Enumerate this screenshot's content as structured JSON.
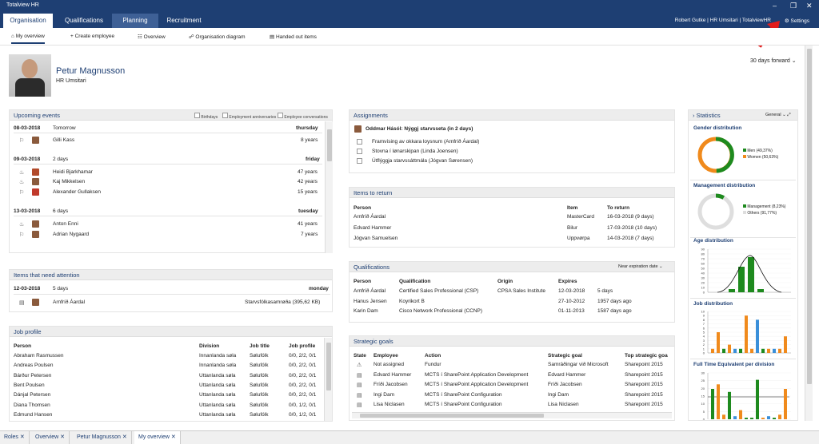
{
  "window": {
    "title": "Totalview HR"
  },
  "nav": {
    "tabs": [
      "Organisation",
      "Qualifications",
      "Planning",
      "Recruitment"
    ],
    "user": "Robert Gutke | HR Umsitari | TotalviewHR",
    "settings": "Settings"
  },
  "subnav": {
    "items": [
      "My overview",
      "Create employee",
      "Overview",
      "Organisation diagram",
      "Handed out items"
    ]
  },
  "profile": {
    "name": "Petur Magnusson",
    "role": "HR Umsitari",
    "period": "30 days forward"
  },
  "upcoming": {
    "title": "Upcoming events",
    "filters": [
      "Birthdays",
      "Employment anniversaries",
      "Employee conversations"
    ],
    "groups": [
      {
        "date": "08-03-2018",
        "rel": "Tomorrow",
        "day": "thursday",
        "people": [
          {
            "name": "Gilli Kass",
            "val": "8 years"
          }
        ]
      },
      {
        "date": "09-03-2018",
        "rel": "2 days",
        "day": "friday",
        "people": [
          {
            "name": "Heidi Bjarkhamar",
            "val": "47 years"
          },
          {
            "name": "Kaj Mikkelsen",
            "val": "42 years"
          },
          {
            "name": "Alexander Gullaksen",
            "val": "15 years"
          }
        ]
      },
      {
        "date": "13-03-2018",
        "rel": "6 days",
        "day": "tuesday",
        "people": [
          {
            "name": "Anton Enni",
            "val": "41 years"
          },
          {
            "name": "Adrian Nygaard",
            "val": "7 years"
          }
        ]
      }
    ]
  },
  "attention": {
    "title": "Items that need attention",
    "date": "12-03-2018",
    "rel": "5 days",
    "day": "monday",
    "person": "Arnfríð Áardal",
    "doc": "Starvsfólkasamrøða (395,62 KB)"
  },
  "job": {
    "title": "Job profile",
    "headers": [
      "Person",
      "Division",
      "Job title",
      "Job profile"
    ],
    "rows": [
      [
        "Abraham Rasmussen",
        "Innanlanda søla",
        "Sølufólk",
        "0/0, 2/2, 0/1"
      ],
      [
        "Andreas Poulsen",
        "Innanlanda søla",
        "Sølufólk",
        "0/0, 2/2, 0/1"
      ],
      [
        "Bárður Petersen",
        "Uttanlanda søla",
        "Sølufólk",
        "0/0, 2/2, 0/1"
      ],
      [
        "Bent Poulsen",
        "Uttanlanda søla",
        "Sølufólk",
        "0/0, 2/2, 0/1"
      ],
      [
        "Dánjal Petersen",
        "Uttanlanda søla",
        "Sølufólk",
        "0/0, 2/2, 0/1"
      ],
      [
        "Diana Thomsen",
        "Uttanlanda søla",
        "Sølufólk",
        "0/0, 1/2, 0/1"
      ],
      [
        "Edmund Hansen",
        "Uttanlanda søla",
        "Sølufólk",
        "0/0, 1/2, 0/1"
      ]
    ]
  },
  "assignments": {
    "title": "Assignments",
    "heading": "Oddmar Hásól: Nýggj starvsseta (in 2 days)",
    "items": [
      "Framvísing av okkara loysnum (Arnfríð Áardal)",
      "Stovna í lønarskipan (Linda Joensen)",
      "Útflýggja starvssáttmála (Jógvan Sørensen)"
    ]
  },
  "items_return": {
    "title": "Items to return",
    "headers": [
      "Person",
      "Item",
      "To return"
    ],
    "rows": [
      [
        "Arnfríð Áardal",
        "MasterCard",
        "16-03-2018 (9 days)"
      ],
      [
        "Edvard Hammer",
        "Bilur",
        "17-03-2018 (10 days)"
      ],
      [
        "Jógvan Samuelsen",
        "Uppvørpa",
        "14-03-2018 (7 days)"
      ]
    ]
  },
  "qualifications": {
    "title": "Qualifications",
    "filter": "Near expiration date",
    "headers": [
      "Person",
      "Qualification",
      "Origin",
      "Expires",
      ""
    ],
    "rows": [
      [
        "Arnfríð Áardal",
        "Certified Sales Professional (CSP)",
        "CPSA Sales Institute",
        "12-03-2018",
        "5 days"
      ],
      [
        "Hanus Jensen",
        "Koyrikort B",
        "",
        "27-10-2012",
        "1957 days ago"
      ],
      [
        "Karin Dam",
        "Cisco Network Professional (CCNP)",
        "",
        "01-11-2013",
        "1587 days ago"
      ]
    ]
  },
  "goals": {
    "title": "Strategic goals",
    "headers": [
      "State",
      "Employee",
      "Action",
      "Strategic goal",
      "Top strategic goa"
    ],
    "rows": [
      [
        "Not assigned",
        "Fundur",
        "Samráðingar við Microsoft",
        "Sharepoint 2015"
      ],
      [
        "Edvard Hammer",
        "MCTS í SharePoint Application Development",
        "Edvard Hammer",
        "Sharepoint 2015"
      ],
      [
        "Fríði Jacobsen",
        "MCTS í SharePoint Application Development",
        "Fríði Jacobsen",
        "Sharepoint 2015"
      ],
      [
        "Ingi Dam",
        "MCTS í SharePoint Configuration",
        "Ingi Dam",
        "Sharepoint 2015"
      ],
      [
        "Lisa Niclasen",
        "MCTS í SharePoint Configuration",
        "Lisa Niclasen",
        "Sharepoint 2015"
      ]
    ]
  },
  "stats": {
    "title": "Statistics",
    "filter": "General",
    "gender": {
      "title": "Gender distribution",
      "legend": [
        "Men (49,37%)",
        "Women (50,63%)"
      ],
      "values": [
        49.37,
        50.63
      ]
    },
    "mgmt": {
      "title": "Management distribution",
      "legend": [
        "Management (8,23%)",
        "Others (91,77%)"
      ],
      "values": [
        8.23,
        91.77
      ]
    },
    "age": {
      "title": "Age distribution",
      "yticks": [
        "90",
        "80",
        "70",
        "60",
        "50",
        "40",
        "30",
        "20",
        "10",
        "0"
      ]
    },
    "jobdist": {
      "title": "Job distribution",
      "yticks": [
        "10",
        "9",
        "8",
        "7",
        "6",
        "5",
        "4",
        "3",
        "2",
        "1",
        "0"
      ]
    },
    "fte": {
      "title": "Full Time Equivalent per division",
      "yticks": [
        "30",
        "25",
        "20",
        "15",
        "10",
        "5",
        "0"
      ]
    }
  },
  "colors": {
    "green": "#1e8a1e",
    "orange": "#f08a1c",
    "blue": "#3a8fd9",
    "navy": "#1e3f73"
  },
  "bottom_tabs": [
    "Roles",
    "Overview",
    "Petur Magnusson",
    "My overview"
  ]
}
